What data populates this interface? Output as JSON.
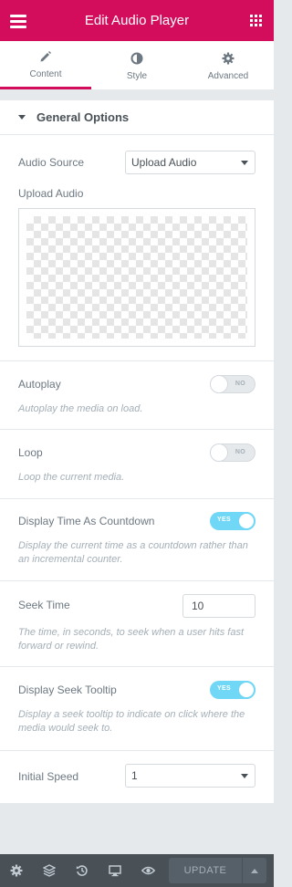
{
  "header": {
    "title": "Edit Audio Player"
  },
  "tabs": [
    {
      "label": "Content",
      "icon": "pencil-icon"
    },
    {
      "label": "Style",
      "icon": "contrast-icon"
    },
    {
      "label": "Advanced",
      "icon": "gear-icon"
    }
  ],
  "section": {
    "title": "General Options"
  },
  "fields": {
    "audio_source": {
      "label": "Audio Source",
      "value": "Upload Audio"
    },
    "upload_audio": {
      "label": "Upload Audio"
    },
    "autoplay": {
      "label": "Autoplay",
      "state": "NO",
      "description": "Autoplay the media on load."
    },
    "loop": {
      "label": "Loop",
      "state": "NO",
      "description": "Loop the current media."
    },
    "countdown": {
      "label": "Display Time As Countdown",
      "state": "YES",
      "description": "Display the current time as a countdown rather than an incremental counter."
    },
    "seek_time": {
      "label": "Seek Time",
      "value": "10",
      "description": "The time, in seconds, to seek when a user hits fast forward or rewind."
    },
    "seek_tooltip": {
      "label": "Display Seek Tooltip",
      "state": "YES",
      "description": "Display a seek tooltip to indicate on click where the media would seek to."
    },
    "initial_speed": {
      "label": "Initial Speed",
      "value": "1"
    }
  },
  "footer": {
    "icons": [
      "gear-icon",
      "layers-icon",
      "history-icon",
      "desktop-icon",
      "eye-icon"
    ],
    "update_label": "UPDATE"
  },
  "colors": {
    "brand": "#d30c5c",
    "toggle_on": "#71d7f7",
    "footer": "#495157"
  }
}
